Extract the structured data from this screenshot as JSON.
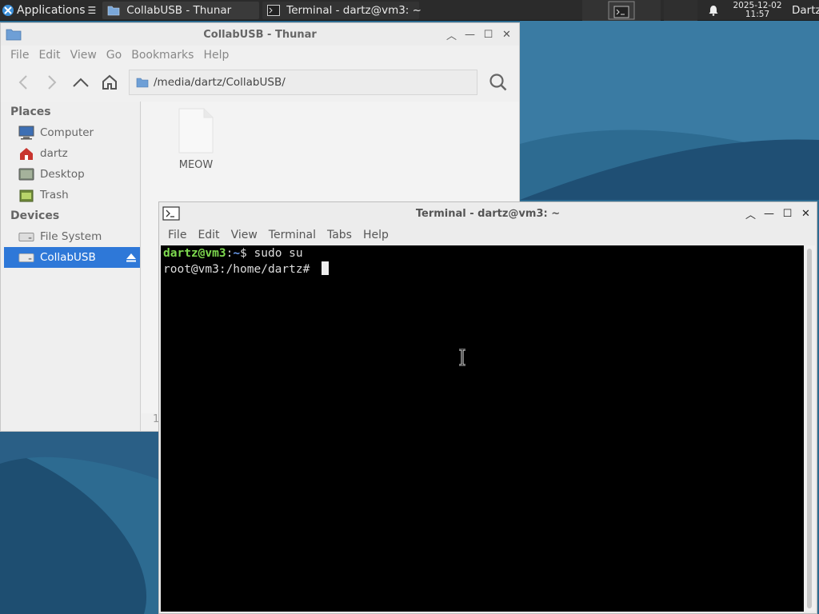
{
  "panel": {
    "applications_label": "Applications",
    "tasks": [
      {
        "label": "CollabUSB - Thunar"
      },
      {
        "label": "Terminal - dartz@vm3: ~"
      }
    ],
    "clock_date": "2025-12-02",
    "clock_time": "11:57",
    "user": "Dartz"
  },
  "thunar": {
    "title": "CollabUSB - Thunar",
    "menu": [
      "File",
      "Edit",
      "View",
      "Go",
      "Bookmarks",
      "Help"
    ],
    "path": "/media/dartz/CollabUSB/",
    "sections": {
      "places_label": "Places",
      "places": [
        "Computer",
        "dartz",
        "Desktop",
        "Trash"
      ],
      "devices_label": "Devices",
      "devices": [
        "File System",
        "CollabUSB"
      ]
    },
    "files": [
      {
        "name": "MEOW"
      }
    ],
    "status_text": "1"
  },
  "terminal": {
    "title": "Terminal - dartz@vm3: ~",
    "menu": [
      "File",
      "Edit",
      "View",
      "Terminal",
      "Tabs",
      "Help"
    ],
    "lines": [
      {
        "user": "dartz@vm3",
        "sep": ":",
        "path": "~",
        "prompt": "$ ",
        "cmd": "sudo su"
      },
      {
        "text": "root@vm3:/home/dartz# "
      }
    ]
  },
  "colors": {
    "panel_bg": "#2b2b2b",
    "selection": "#2e78d8",
    "prompt_user": "#7ed94f",
    "prompt_path": "#6b9df0",
    "wallpaper": "#2a6185"
  }
}
